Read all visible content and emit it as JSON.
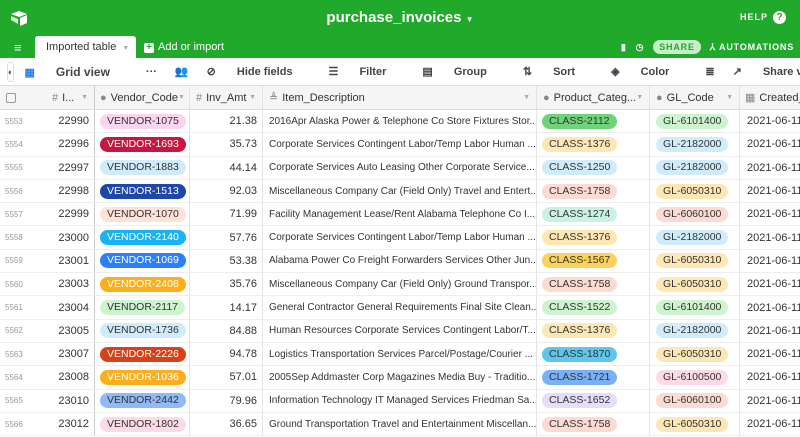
{
  "app": {
    "title": "purchase_invoices",
    "help": "HELP",
    "share": "SHARE",
    "automations": "AUTOMATIONS"
  },
  "tabs": {
    "active": "Imported table",
    "add": "Add or import"
  },
  "toolbar": {
    "view": "Grid view",
    "hide_fields": "Hide fields",
    "filter": "Filter",
    "group": "Group",
    "sort": "Sort",
    "color": "Color",
    "share_view": "Share view"
  },
  "columns": [
    "I...",
    "Vendor_Code",
    "Inv_Amt",
    "Item_Description",
    "Product_Categ...",
    "GL_Code",
    "Created_"
  ],
  "rows": [
    {
      "n": "5553",
      "id": "22990",
      "vendor": "VENDOR-1075",
      "vbg": "#fbd4ef",
      "vfg": "#333",
      "amt": "21.38",
      "desc": "2016Apr Alaska Power & Telephone Co Store Fixtures Stor...",
      "cls": "CLASS-2112",
      "cbg": "#6fd37a",
      "gl": "GL-6101400",
      "gbg": "#cdf3cf",
      "date": "2021-06-11"
    },
    {
      "n": "5554",
      "id": "22996",
      "vendor": "VENDOR-1693",
      "vbg": "#c8163f",
      "vfg": "#fff",
      "amt": "35.73",
      "desc": "Corporate Services Contingent Labor/Temp Labor Human ...",
      "cls": "CLASS-1376",
      "cbg": "#fde8b5",
      "gl": "GL-2182000",
      "gbg": "#d0ecfb",
      "date": "2021-06-11"
    },
    {
      "n": "5555",
      "id": "22997",
      "vendor": "VENDOR-1883",
      "vbg": "#d0ecfb",
      "vfg": "#333",
      "amt": "44.14",
      "desc": "Corporate Services Auto Leasing Other Corporate Service...",
      "cls": "CLASS-1250",
      "cbg": "#d0ecfb",
      "gl": "GL-2182000",
      "gbg": "#d0ecfb",
      "date": "2021-06-11"
    },
    {
      "n": "5556",
      "id": "22998",
      "vendor": "VENDOR-1513",
      "vbg": "#1f47a8",
      "vfg": "#fff",
      "amt": "92.03",
      "desc": "Miscellaneous Company Car (Field Only) Travel and Entert...",
      "cls": "CLASS-1758",
      "cbg": "#fddad2",
      "gl": "GL-6050310",
      "gbg": "#fde8b5",
      "date": "2021-06-11"
    },
    {
      "n": "5557",
      "id": "22999",
      "vendor": "VENDOR-1070",
      "vbg": "#fde2d8",
      "vfg": "#333",
      "amt": "71.99",
      "desc": "Facility Management Lease/Rent Alabama Telephone Co I...",
      "cls": "CLASS-1274",
      "cbg": "#c9f2e6",
      "gl": "GL-6060100",
      "gbg": "#fddad2",
      "date": "2021-06-11"
    },
    {
      "n": "5558",
      "id": "23000",
      "vendor": "VENDOR-2140",
      "vbg": "#1ab3f2",
      "vfg": "#fff",
      "amt": "57.76",
      "desc": "Corporate Services Contingent Labor/Temp Labor Human ...",
      "cls": "CLASS-1376",
      "cbg": "#fde8b5",
      "gl": "GL-2182000",
      "gbg": "#d0ecfb",
      "date": "2021-06-11"
    },
    {
      "n": "5559",
      "id": "23001",
      "vendor": "VENDOR-1069",
      "vbg": "#2d7ff9",
      "vfg": "#fff",
      "amt": "53.38",
      "desc": "Alabama Power Co Freight Forwarders Services Other Jun...",
      "cls": "CLASS-1567",
      "cbg": "#fcd25a",
      "gl": "GL-6050310",
      "gbg": "#fde8b5",
      "date": "2021-06-11"
    },
    {
      "n": "5560",
      "id": "23003",
      "vendor": "VENDOR-2408",
      "vbg": "#fcae1c",
      "vfg": "#fff",
      "amt": "35.76",
      "desc": "Miscellaneous Company Car (Field Only) Ground Transpor...",
      "cls": "CLASS-1758",
      "cbg": "#fddad2",
      "gl": "GL-6050310",
      "gbg": "#fde8b5",
      "date": "2021-06-11"
    },
    {
      "n": "5561",
      "id": "23004",
      "vendor": "VENDOR-2117",
      "vbg": "#cdf3cf",
      "vfg": "#333",
      "amt": "14.17",
      "desc": "General Contractor General Requirements Final Site Clean...",
      "cls": "CLASS-1522",
      "cbg": "#cdf3cf",
      "gl": "GL-6101400",
      "gbg": "#cdf3cf",
      "date": "2021-06-11"
    },
    {
      "n": "5562",
      "id": "23005",
      "vendor": "VENDOR-1736",
      "vbg": "#d0ecfb",
      "vfg": "#333",
      "amt": "84.88",
      "desc": "Human Resources Corporate Services Contingent Labor/T...",
      "cls": "CLASS-1376",
      "cbg": "#fde8b5",
      "gl": "GL-2182000",
      "gbg": "#d0ecfb",
      "date": "2021-06-11"
    },
    {
      "n": "5563",
      "id": "23007",
      "vendor": "VENDOR-2226",
      "vbg": "#d8401a",
      "vfg": "#fff",
      "amt": "94.78",
      "desc": "Logistics Transportation Services Parcel/Postage/Courier ...",
      "cls": "CLASS-1870",
      "cbg": "#5dc6ec",
      "gl": "GL-6050310",
      "gbg": "#fde8b5",
      "date": "2021-06-11"
    },
    {
      "n": "5564",
      "id": "23008",
      "vendor": "VENDOR-1036",
      "vbg": "#fcae1c",
      "vfg": "#fff",
      "amt": "57.01",
      "desc": "2005Sep Addmaster Corp Magazines Media Buy - Traditio...",
      "cls": "CLASS-1721",
      "cbg": "#7ab0f5",
      "gl": "GL-6100500",
      "gbg": "#fddbe4",
      "date": "2021-06-11"
    },
    {
      "n": "5565",
      "id": "23010",
      "vendor": "VENDOR-2442",
      "vbg": "#8fbaf7",
      "vfg": "#333",
      "amt": "79.96",
      "desc": "Information Technology IT Managed Services Friedman Sa...",
      "cls": "CLASS-1652",
      "cbg": "#e6dcfb",
      "gl": "GL-6060100",
      "gbg": "#fddad2",
      "date": "2021-06-11"
    },
    {
      "n": "5566",
      "id": "23012",
      "vendor": "VENDOR-1802",
      "vbg": "#fddbe4",
      "vfg": "#333",
      "amt": "36.65",
      "desc": "Ground Transportation Travel and Entertainment Miscellan...",
      "cls": "CLASS-1758",
      "cbg": "#fddad2",
      "gl": "GL-6050310",
      "gbg": "#fde8b5",
      "date": "2021-06-11"
    }
  ]
}
